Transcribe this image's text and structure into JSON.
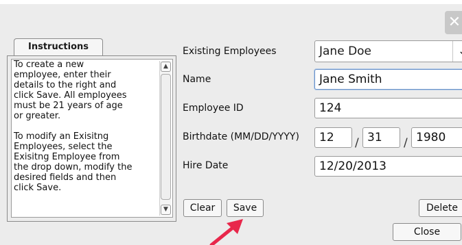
{
  "window": {
    "close_glyph": "✕"
  },
  "instructions": {
    "tab_label": "Instructions",
    "paragraphs": [
      "To create a new\nemployee, enter their\ndetails to the right and\nclick Save. All employees\nmust be 21 years of age\nor greater.",
      "To modify an Exisitng\nEmployees, select the\nExisitng Employee from\nthe drop down, modify the\ndesired fields and then\nclick Save."
    ]
  },
  "form": {
    "existing_label": "Existing Employees",
    "existing_selected": "Jane Doe",
    "name_label": "Name",
    "name_value": "Jane Smith",
    "employee_id_label": "Employee ID",
    "employee_id_value": "124",
    "birthdate_label": "Birthdate (MM/DD/YYYY)",
    "birth_month": "12",
    "birth_day": "31",
    "birth_year": "1980",
    "date_separator": "/",
    "hire_date_label": "Hire Date",
    "hire_date_value": "12/20/2013"
  },
  "buttons": {
    "clear": "Clear",
    "save": "Save",
    "delete": "Delete",
    "close": "Close"
  },
  "icons": {
    "dropdown": "chevron-down-icon",
    "scroll_up": "chevron-up-icon",
    "scroll_down": "chevron-down-icon",
    "annotation": "arrow-pointer-icon"
  },
  "colors": {
    "annotation_arrow": "#e8274b",
    "focus_border": "#6a92c8"
  }
}
